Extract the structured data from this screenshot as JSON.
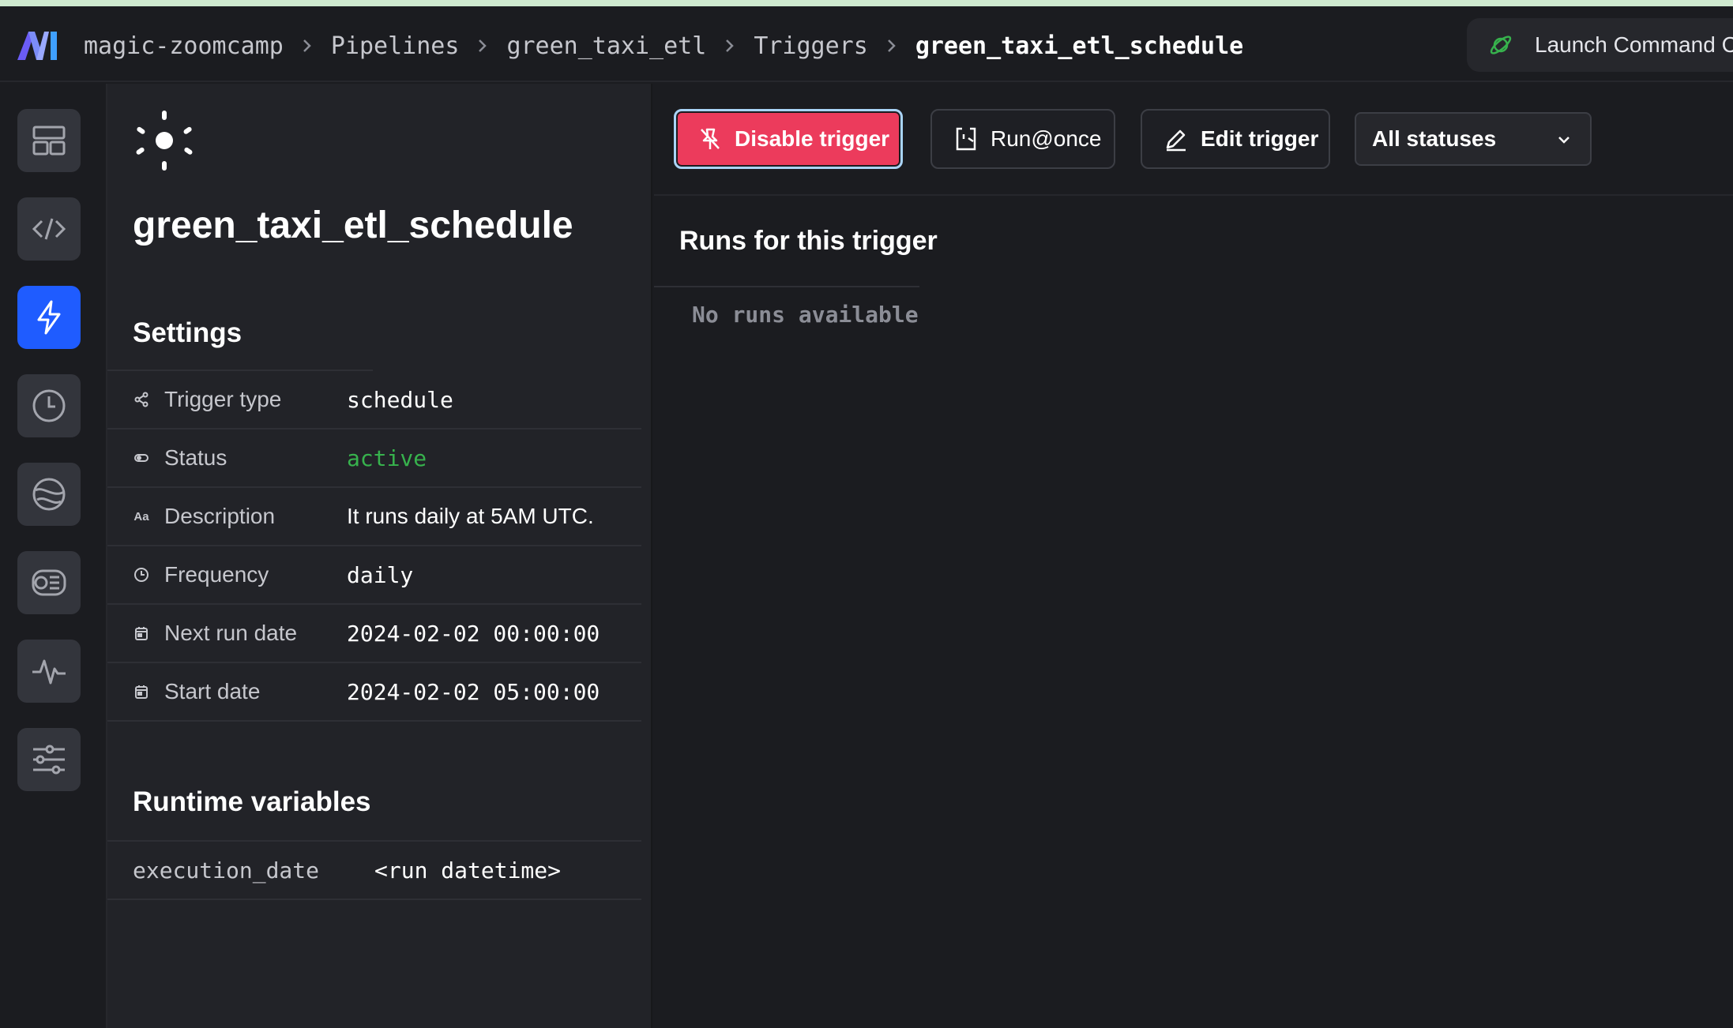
{
  "header": {
    "breadcrumb": [
      "magic-zoomcamp",
      "Pipelines",
      "green_taxi_etl",
      "Triggers",
      "green_taxi_etl_schedule"
    ],
    "launch_label": "Launch Command C"
  },
  "rail": {
    "items": [
      "overview-icon",
      "code-icon",
      "triggers-icon",
      "runs-icon",
      "backfills-icon",
      "block-runs-icon",
      "monitor-icon",
      "settings-sliders-icon"
    ],
    "active_index": 2
  },
  "trigger": {
    "title": "green_taxi_etl_schedule"
  },
  "settings": {
    "heading": "Settings",
    "rows": [
      {
        "label": "Trigger type",
        "value": "schedule",
        "icon": "share-icon"
      },
      {
        "label": "Status",
        "value": "active",
        "icon": "toggle-icon"
      },
      {
        "label": "Description",
        "value": "It runs daily at 5AM UTC.",
        "icon": "text-icon"
      },
      {
        "label": "Frequency",
        "value": "daily",
        "icon": "clock-icon"
      },
      {
        "label": "Next run date",
        "value": "2024-02-02 00:00:00",
        "icon": "calendar-icon"
      },
      {
        "label": "Start date",
        "value": "2024-02-02 05:00:00",
        "icon": "calendar-icon"
      }
    ],
    "text_icon_glyph": "Aa"
  },
  "runtime": {
    "heading": "Runtime variables",
    "rows": [
      {
        "name": "execution_date",
        "value": "<run datetime>"
      }
    ]
  },
  "toolbar": {
    "disable_label": "Disable trigger",
    "run_once_label": "Run@once",
    "edit_label": "Edit trigger",
    "status_filter": "All statuses"
  },
  "runs": {
    "heading": "Runs for this trigger",
    "empty_text": "No runs available"
  },
  "colors": {
    "accent": "#1f5cff",
    "danger": "#ec3b5c",
    "active_status": "#37b24d"
  }
}
